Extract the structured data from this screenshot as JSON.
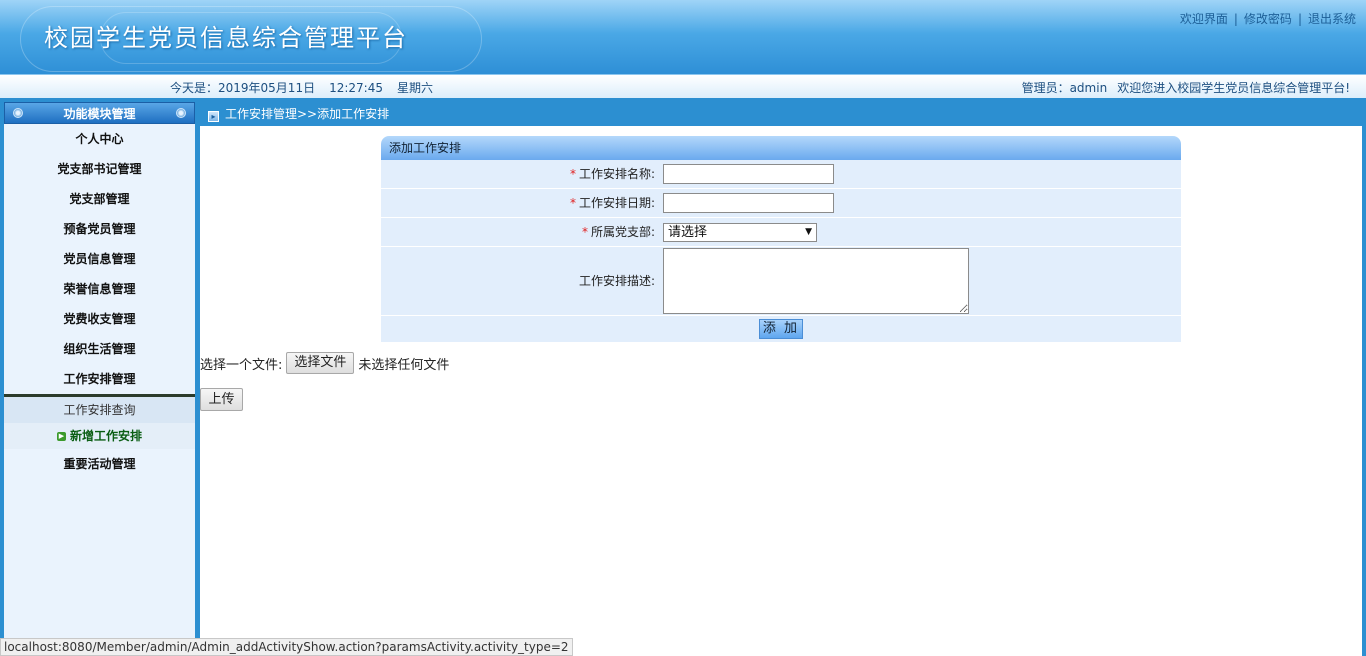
{
  "header": {
    "title": "校园学生党员信息综合管理平台",
    "links": [
      "欢迎界面",
      "修改密码",
      "退出系统"
    ],
    "separator": "|"
  },
  "infobar": {
    "date_prefix": "今天是：2019年05月11日",
    "time": "12:27:45",
    "weekday": "星期六",
    "admin_label": "管理员：admin",
    "welcome": "欢迎您进入校园学生党员信息综合管理平台!"
  },
  "sidebar": {
    "title": "功能模块管理",
    "items": [
      {
        "label": "个人中心"
      },
      {
        "label": "党支部书记管理"
      },
      {
        "label": "党支部管理"
      },
      {
        "label": "预备党员管理"
      },
      {
        "label": "党员信息管理"
      },
      {
        "label": "荣誉信息管理"
      },
      {
        "label": "党费收支管理"
      },
      {
        "label": "组织生活管理"
      },
      {
        "label": "工作安排管理"
      }
    ],
    "submenu": [
      {
        "label": "工作安排查询",
        "active": false
      },
      {
        "label": "新增工作安排",
        "active": true
      }
    ],
    "after": [
      {
        "label": "重要活动管理"
      }
    ]
  },
  "breadcrumb": "工作安排管理>>添加工作安排",
  "form": {
    "title": "添加工作安排",
    "required_mark": "*",
    "name_label": "工作安排名称:",
    "date_label": "工作安排日期:",
    "branch_label": "所属党支部:",
    "branch_value": "请选择",
    "desc_label": "工作安排描述:",
    "submit": "添 加"
  },
  "upload": {
    "prompt": "选择一个文件:",
    "choose_button": "选择文件",
    "no_file": "未选择任何文件",
    "upload_button": "上传"
  },
  "status_url": "localhost:8080/Member/admin/Admin_addActivityShow.action?paramsActivity.activity_type=2",
  "colors": {
    "header_blue": "#2e8fd6",
    "frame_blue": "#2c8fd1",
    "form_row_bg": "#e2eefc",
    "required_red": "#e02020"
  },
  "icons": {
    "crumb": "arrow-square-icon",
    "active_sub": "green-arrow-icon",
    "select_caret": "caret-down-icon"
  }
}
